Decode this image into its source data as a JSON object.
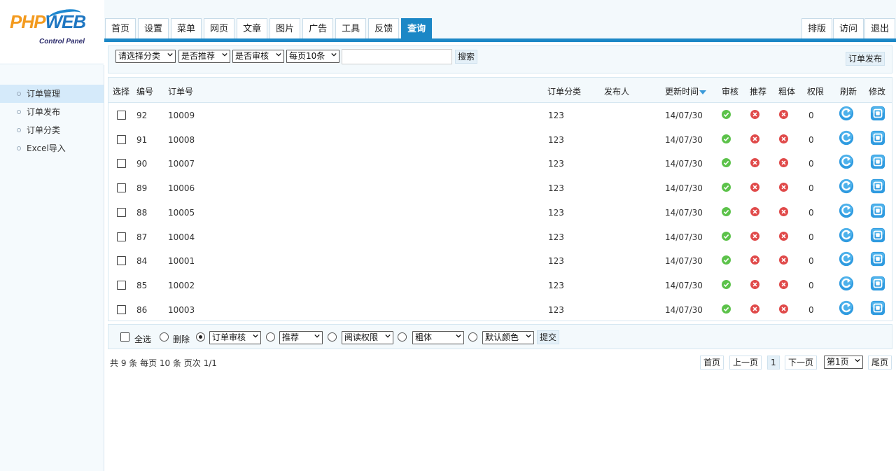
{
  "logo": {
    "brand_left": "PHP",
    "brand_right": "WEB",
    "subtitle": "Control Panel"
  },
  "nav": {
    "tabs": [
      "首页",
      "设置",
      "菜单",
      "网页",
      "文章",
      "图片",
      "广告",
      "工具",
      "反馈",
      "查询"
    ],
    "active_tab": "查询",
    "right_tabs": [
      "排版",
      "访问",
      "退出"
    ]
  },
  "sidebar": {
    "items": [
      "订单管理",
      "订单发布",
      "订单分类",
      "Excel导入"
    ],
    "active_item": "订单管理"
  },
  "filter": {
    "category_select": "请选择分类",
    "recommend_select": "是否推荐",
    "audit_select": "是否审核",
    "pagesize_select": "每页10条",
    "search_value": "",
    "search_button": "搜索",
    "publish_button": "订单发布"
  },
  "table": {
    "headers": {
      "select": "选择",
      "id": "编号",
      "order_no": "订单号",
      "category": "订单分类",
      "publisher": "发布人",
      "updated": "更新时间",
      "audit": "审核",
      "recommend": "推荐",
      "bold": "粗体",
      "permission": "权限",
      "refresh": "刷新",
      "edit": "修改"
    },
    "rows": [
      {
        "id": "92",
        "order_no": "10009",
        "category": "123",
        "publisher": "",
        "updated": "14/07/30",
        "audited": true,
        "recommended": false,
        "bold": false,
        "permission": "0"
      },
      {
        "id": "91",
        "order_no": "10008",
        "category": "123",
        "publisher": "",
        "updated": "14/07/30",
        "audited": true,
        "recommended": false,
        "bold": false,
        "permission": "0"
      },
      {
        "id": "90",
        "order_no": "10007",
        "category": "123",
        "publisher": "",
        "updated": "14/07/30",
        "audited": true,
        "recommended": false,
        "bold": false,
        "permission": "0"
      },
      {
        "id": "89",
        "order_no": "10006",
        "category": "123",
        "publisher": "",
        "updated": "14/07/30",
        "audited": true,
        "recommended": false,
        "bold": false,
        "permission": "0"
      },
      {
        "id": "88",
        "order_no": "10005",
        "category": "123",
        "publisher": "",
        "updated": "14/07/30",
        "audited": true,
        "recommended": false,
        "bold": false,
        "permission": "0"
      },
      {
        "id": "87",
        "order_no": "10004",
        "category": "123",
        "publisher": "",
        "updated": "14/07/30",
        "audited": true,
        "recommended": false,
        "bold": false,
        "permission": "0"
      },
      {
        "id": "84",
        "order_no": "10001",
        "category": "123",
        "publisher": "",
        "updated": "14/07/30",
        "audited": true,
        "recommended": false,
        "bold": false,
        "permission": "0"
      },
      {
        "id": "85",
        "order_no": "10002",
        "category": "123",
        "publisher": "",
        "updated": "14/07/30",
        "audited": true,
        "recommended": false,
        "bold": false,
        "permission": "0"
      },
      {
        "id": "86",
        "order_no": "10003",
        "category": "123",
        "publisher": "",
        "updated": "14/07/30",
        "audited": true,
        "recommended": false,
        "bold": false,
        "permission": "0"
      }
    ]
  },
  "batch": {
    "select_all": "全选",
    "delete": "删除",
    "audit_select": "订单审核",
    "recommend_select": "推荐",
    "permission_select": "阅读权限",
    "bold_select": "粗体",
    "color_select": "默认颜色",
    "submit": "提交"
  },
  "pagination": {
    "summary": "共 9 条 每页 10 条 页次 1/1",
    "first": "首页",
    "prev": "上一页",
    "current": "1",
    "next": "下一页",
    "page_select": "第1页",
    "last": "尾页"
  },
  "colors": {
    "accent": "#1b87c6",
    "check_green": "#5cc24a",
    "cross_red": "#e04a4a",
    "panel_bg": "#f3f9fc"
  },
  "icons": {
    "audited": "check-icon",
    "not_recommended": "cross-icon",
    "not_bold": "cross-icon",
    "refresh": "refresh-icon",
    "edit": "edit-icon"
  }
}
